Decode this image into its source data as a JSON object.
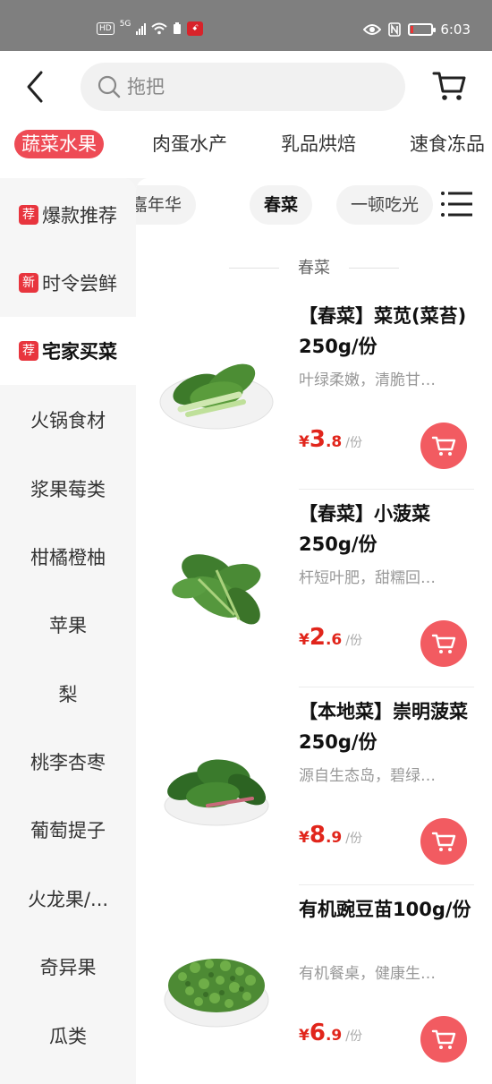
{
  "status_bar": {
    "hd": "HD",
    "net": "5G",
    "time": "6:03",
    "app_icon_text": "ꗃ"
  },
  "header": {
    "search_placeholder": "拖把"
  },
  "top_categories": [
    {
      "label": "蔬菜水果",
      "active": true
    },
    {
      "label": "肉蛋水产",
      "active": false
    },
    {
      "label": "乳品烘焙",
      "active": false
    },
    {
      "label": "速食冻品",
      "active": false
    }
  ],
  "sidebar": [
    {
      "label": "爆款推荐",
      "tag": "荐",
      "active": false
    },
    {
      "label": "时令尝鲜",
      "tag": "新",
      "active": false
    },
    {
      "label": "宅家买菜",
      "tag": "荐",
      "active": true
    },
    {
      "label": "火锅食材",
      "tag": ""
    },
    {
      "label": "浆果莓类",
      "tag": ""
    },
    {
      "label": "柑橘橙柚",
      "tag": ""
    },
    {
      "label": "苹果",
      "tag": ""
    },
    {
      "label": "梨",
      "tag": ""
    },
    {
      "label": "桃李杏枣",
      "tag": ""
    },
    {
      "label": "葡萄提子",
      "tag": ""
    },
    {
      "label": "火龙果/...",
      "tag": ""
    },
    {
      "label": "奇异果",
      "tag": ""
    },
    {
      "label": "瓜类",
      "tag": ""
    }
  ],
  "chips": [
    {
      "label": "嘉年华",
      "active": false
    },
    {
      "label": "春菜",
      "active": true
    },
    {
      "label": "一顿吃光",
      "active": false
    }
  ],
  "section_title": "春菜",
  "products": [
    {
      "name": "【春菜】菜苋(菜苔) 250g/份",
      "desc": "叶绿柔嫩，清脆甘…",
      "currency": "¥",
      "price_int": "3",
      "price_dec": ".8",
      "unit": "/份",
      "image": "bok-choy"
    },
    {
      "name": "【春菜】小菠菜250g/份",
      "desc": "杆短叶肥，甜糯回…",
      "currency": "¥",
      "price_int": "2",
      "price_dec": ".6",
      "unit": "/份",
      "image": "spinach"
    },
    {
      "name": "【本地菜】崇明菠菜250g/份",
      "desc": "源自生态岛，碧绿…",
      "currency": "¥",
      "price_int": "8",
      "price_dec": ".9",
      "unit": "/份",
      "image": "spinach-bunch"
    },
    {
      "name": "有机豌豆苗100g/份",
      "desc": "有机餐桌，健康生…",
      "currency": "¥",
      "price_int": "6",
      "price_dec": ".9",
      "unit": "/份",
      "image": "pea-shoots"
    }
  ],
  "colors": {
    "accent": "#ee4b55",
    "price": "#e1251b",
    "cart_button": "#f25b61"
  }
}
